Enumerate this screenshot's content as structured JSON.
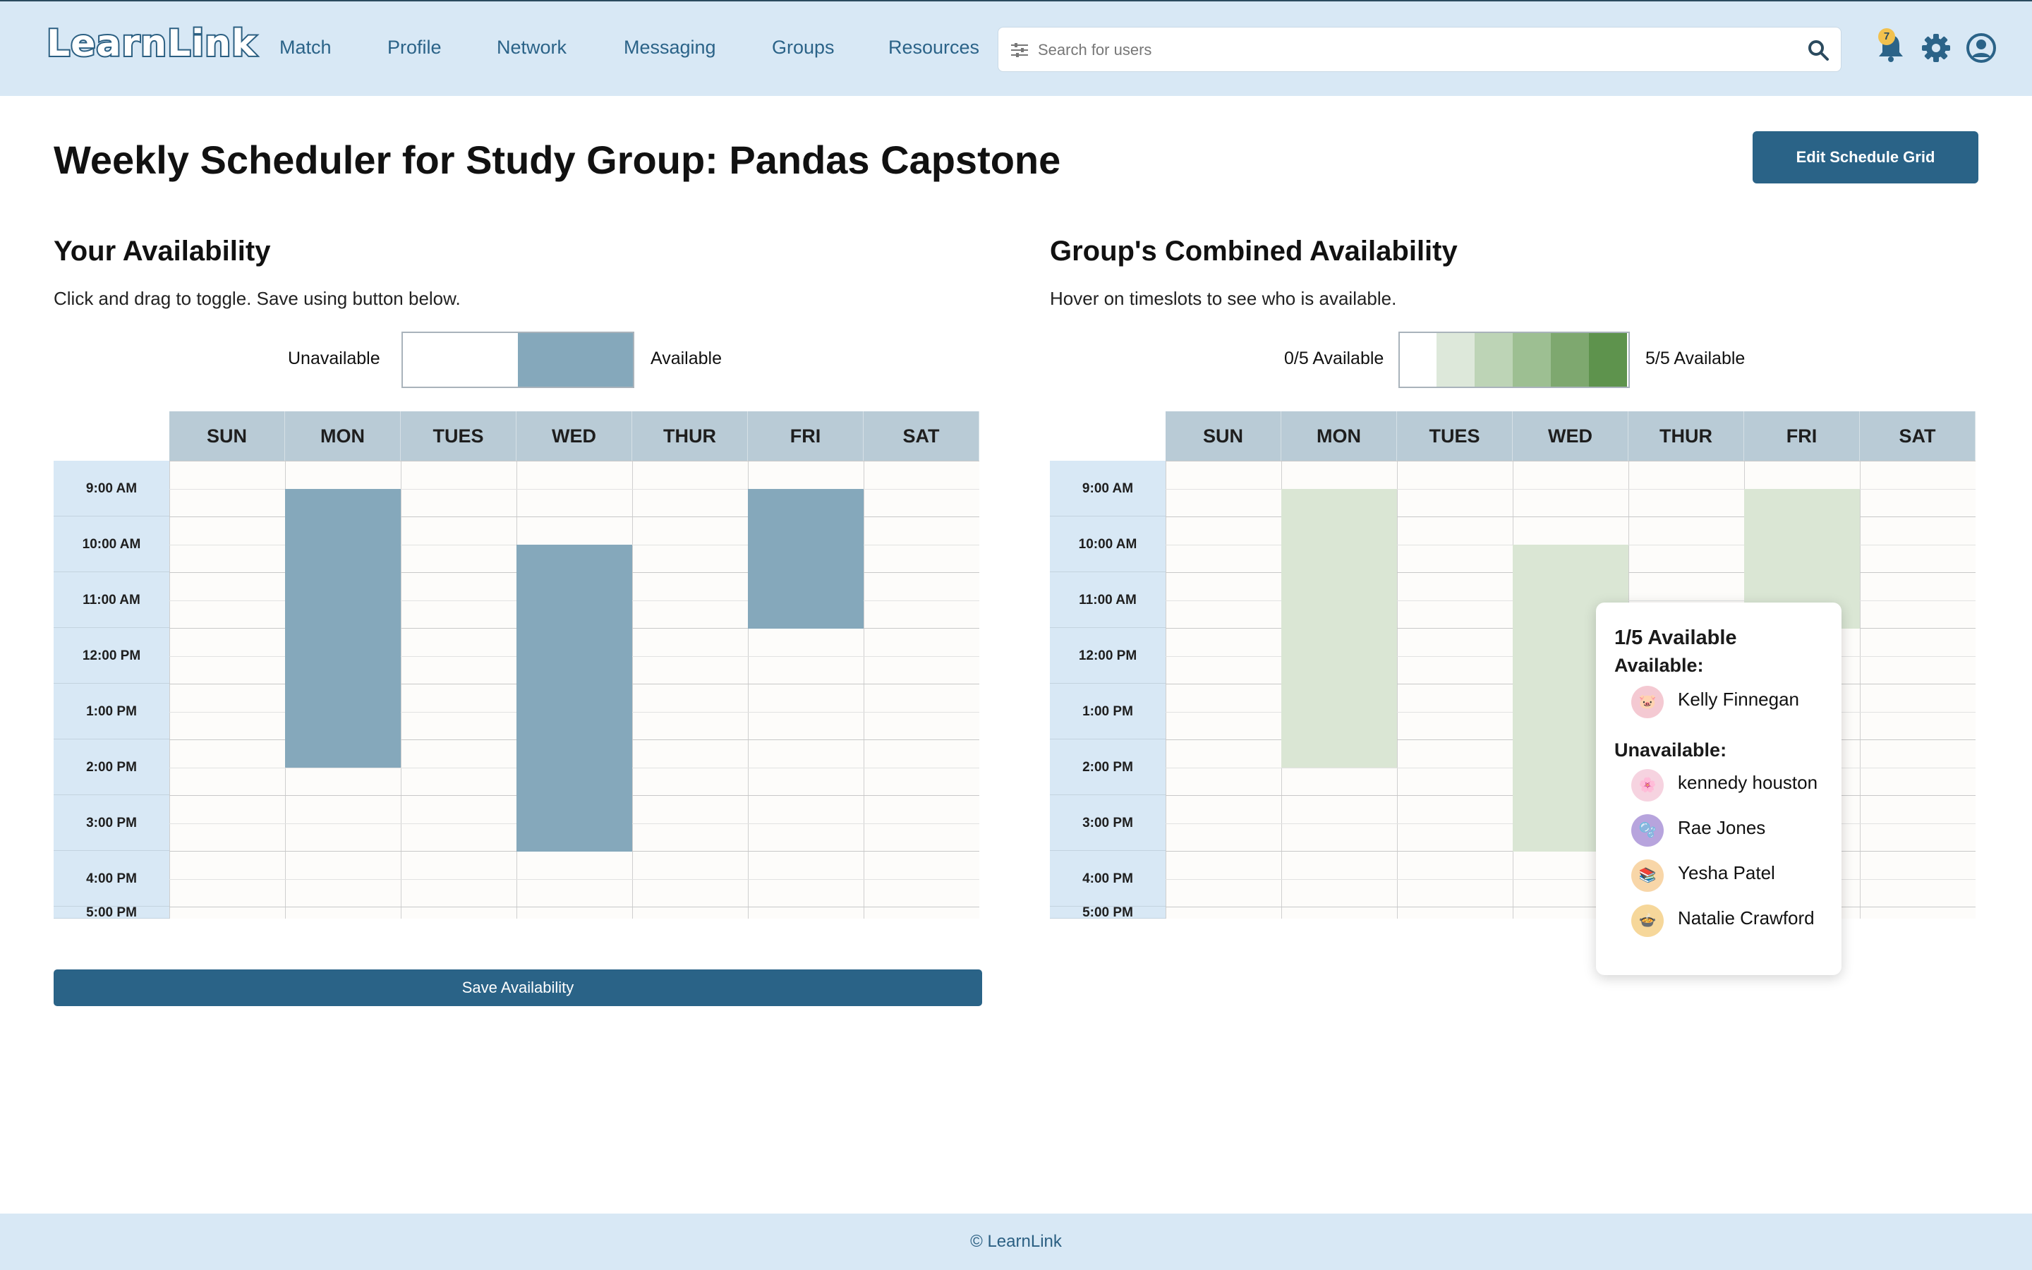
{
  "app": {
    "logo": "LearnLink"
  },
  "nav": {
    "items": [
      "Match",
      "Profile",
      "Network",
      "Messaging",
      "Groups",
      "Resources"
    ]
  },
  "search": {
    "placeholder": "Search for users",
    "value": ""
  },
  "header": {
    "notifications_count": "7"
  },
  "page": {
    "title_prefix": "Weekly Scheduler for Study Group:",
    "group_name": "Pandas Capstone",
    "edit_button": "Edit Schedule Grid"
  },
  "your_availability": {
    "heading": "Your Availability",
    "subtext": "Click and drag to toggle. Save using button below.",
    "legend_unavailable": "Unavailable",
    "legend_available": "Available",
    "available_color": "#85a8bb",
    "save_button": "Save Availability",
    "blocks": [
      {
        "day": "MON",
        "start": "9:30 AM",
        "end": "2:30 PM"
      },
      {
        "day": "WED",
        "start": "10:30 AM",
        "end": "4:00 PM"
      },
      {
        "day": "FRI",
        "start": "9:30 AM",
        "end": "12:00 PM"
      }
    ]
  },
  "group_availability": {
    "heading": "Group's Combined Availability",
    "subtext": "Hover on timeslots to see who is available.",
    "legend_min": "0/5 Available",
    "legend_max": "5/5 Available",
    "legend_colors": [
      "#ffffff",
      "#dde8da",
      "#bdd4b6",
      "#9dbf92",
      "#7ea86f",
      "#5e934d"
    ],
    "block_color": "#dae6d4",
    "blocks": [
      {
        "day": "MON",
        "start": "9:30 AM",
        "end": "2:30 PM",
        "available": 1
      },
      {
        "day": "WED",
        "start": "10:30 AM",
        "end": "4:00 PM",
        "available": 1
      },
      {
        "day": "FRI",
        "start": "9:30 AM",
        "end": "12:00 PM",
        "available": 1
      }
    ]
  },
  "days": [
    "SUN",
    "MON",
    "TUES",
    "WED",
    "THUR",
    "FRI",
    "SAT"
  ],
  "times": [
    "9:00 AM",
    "10:00 AM",
    "11:00 AM",
    "12:00 PM",
    "1:00 PM",
    "2:00 PM",
    "3:00 PM",
    "4:00 PM",
    "5:00 PM"
  ],
  "tooltip": {
    "count": "1/5 Available",
    "available_heading": "Available:",
    "unavailable_heading": "Unavailable:",
    "available": [
      {
        "name": "Kelly Finnegan",
        "avatar_icon": "pig-icon",
        "avatar_glyph": "🐷",
        "avatar_color": "#f4c9d2"
      }
    ],
    "unavailable": [
      {
        "name": "kennedy houston",
        "avatar_icon": "flower-icon",
        "avatar_glyph": "🌸",
        "avatar_color": "#f6d3e0"
      },
      {
        "name": "Rae Jones",
        "avatar_icon": "bubble-icon",
        "avatar_glyph": "🫧",
        "avatar_color": "#b7a4dd"
      },
      {
        "name": "Yesha Patel",
        "avatar_icon": "books-icon",
        "avatar_glyph": "📚",
        "avatar_color": "#f8d6a8"
      },
      {
        "name": "Natalie Crawford",
        "avatar_icon": "pot-icon",
        "avatar_glyph": "🍲",
        "avatar_color": "#f6d79a"
      }
    ]
  },
  "footer": {
    "text": "© LearnLink"
  }
}
